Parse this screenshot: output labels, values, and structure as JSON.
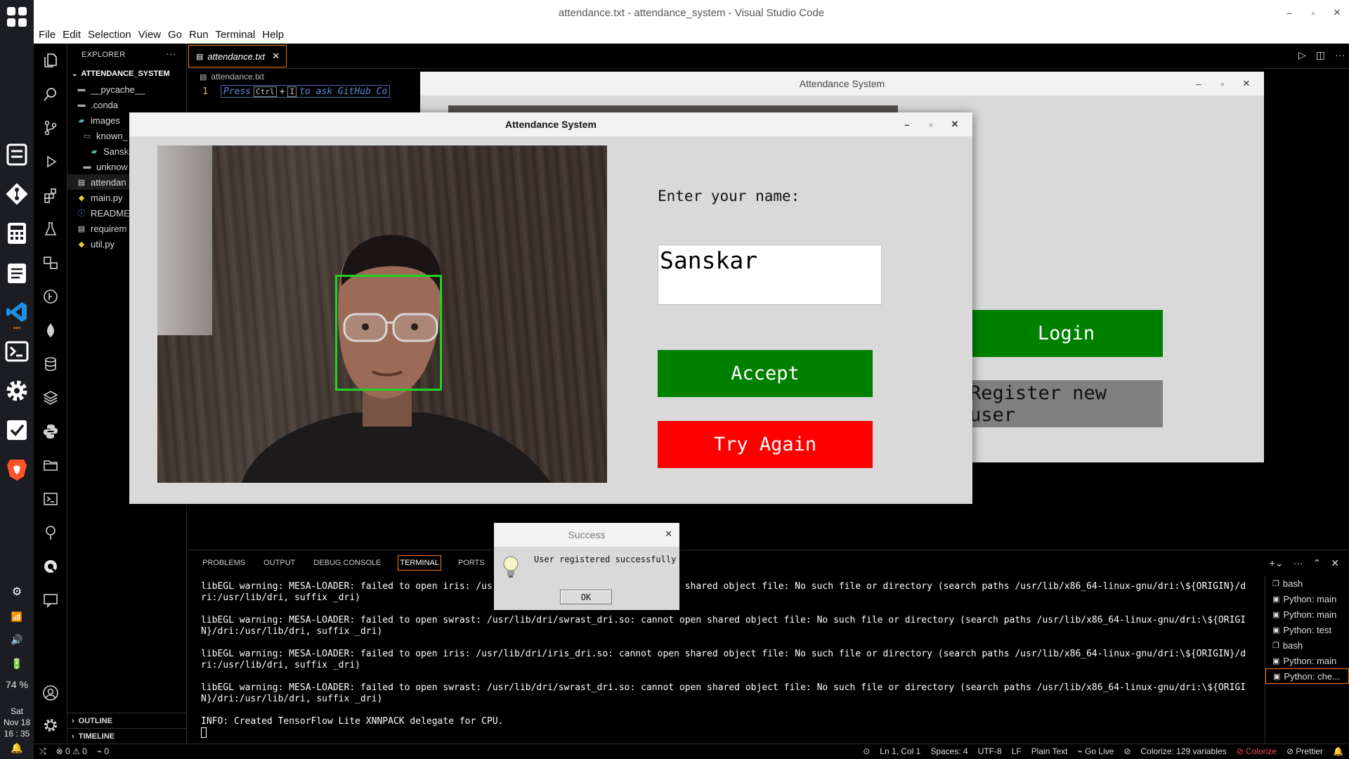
{
  "window_title": "attendance.txt - attendance_system - Visual Studio Code",
  "menu": [
    "File",
    "Edit",
    "Selection",
    "View",
    "Go",
    "Run",
    "Terminal",
    "Help"
  ],
  "sidebar": {
    "header": "EXPLORER",
    "project": "ATTENDANCE_SYSTEM",
    "items": [
      {
        "label": "__pycache__",
        "icon": "folder-icon"
      },
      {
        "label": ".conda",
        "icon": "folder-icon"
      },
      {
        "label": "images",
        "icon": "folder-icon"
      },
      {
        "label": "known_",
        "icon": "folder-icon"
      },
      {
        "label": "Sansk",
        "icon": "image-file-icon"
      },
      {
        "label": "unknow",
        "icon": "folder-icon"
      },
      {
        "label": "attendan",
        "icon": "text-file-icon"
      },
      {
        "label": "main.py",
        "icon": "python-file-icon"
      },
      {
        "label": "README",
        "icon": "info-file-icon"
      },
      {
        "label": "requirem",
        "icon": "text-file-icon"
      },
      {
        "label": "util.py",
        "icon": "python-file-icon"
      }
    ],
    "outline": "OUTLINE",
    "timeline": "TIMELINE"
  },
  "editor": {
    "tab_label": "attendance.txt",
    "breadcrumb": "attendance.txt",
    "line_number": "1",
    "hint_press": "Press",
    "hint_ctrl": "Ctrl",
    "hint_plus": "+",
    "hint_i": "I",
    "hint_text": "to ask GitHub Co"
  },
  "panel": {
    "tabs": [
      "PROBLEMS",
      "OUTPUT",
      "DEBUG CONSOLE",
      "TERMINAL",
      "PORTS"
    ],
    "active_tab": "TERMINAL",
    "terminal_lines": [
      "libEGL warning: MESA-LOADER: failed to open iris: /usr/lib/dri/iris_dri.so: cannot open shared object file: No such file or directory (search paths /usr/lib/x86_64-linux-gnu/dri:\\${ORIGIN}/dri:/usr/lib/dri, suffix _dri)",
      "libEGL warning: MESA-LOADER: failed to open swrast: /usr/lib/dri/swrast_dri.so: cannot open shared object file: No such file or directory (search paths /usr/lib/x86_64-linux-gnu/dri:\\${ORIGIN}/dri:/usr/lib/dri, suffix _dri)",
      "libEGL warning: MESA-LOADER: failed to open iris: /usr/lib/dri/iris_dri.so: cannot open shared object file: No such file or directory (search paths /usr/lib/x86_64-linux-gnu/dri:\\${ORIGIN}/dri:/usr/lib/dri, suffix _dri)",
      "libEGL warning: MESA-LOADER: failed to open swrast: /usr/lib/dri/swrast_dri.so: cannot open shared object file: No such file or directory (search paths /usr/lib/x86_64-linux-gnu/dri:\\${ORIGIN}/dri:/usr/lib/dri, suffix _dri)",
      "INFO: Created TensorFlow Lite XNNPACK delegate for CPU."
    ],
    "terminals": [
      "bash",
      "Python: main",
      "Python: main",
      "Python: test",
      "bash",
      "Python: main",
      "Python: che..."
    ]
  },
  "statusbar": {
    "remote": "⤭",
    "errors": "0",
    "warnings": "0",
    "ports": "0",
    "position": "Ln 1, Col 1",
    "spaces": "Spaces: 4",
    "encoding": "UTF-8",
    "eol": "LF",
    "language": "Plain Text",
    "golive": "Go Live",
    "colorize_vars": "Colorize: 129 variables",
    "colorize": "Colorize",
    "prettier": "Prettier"
  },
  "dock": {
    "battery": "74 %",
    "day": "Sat",
    "date": "Nov 18",
    "time": "16 : 35"
  },
  "main_window": {
    "title": "Attendance System",
    "login_label": "Login",
    "register_label": "Register new user",
    "login_color": "#008000",
    "register_color": "#808080"
  },
  "register_window": {
    "title": "Attendance System",
    "prompt": "Enter your name:",
    "name_value": "Sanskar",
    "accept_label": "Accept",
    "try_again_label": "Try Again",
    "accept_color": "#008000",
    "try_again_color": "#ff0000"
  },
  "dialog": {
    "title": "Success",
    "message": "User registered successfully",
    "ok_label": "OK"
  }
}
